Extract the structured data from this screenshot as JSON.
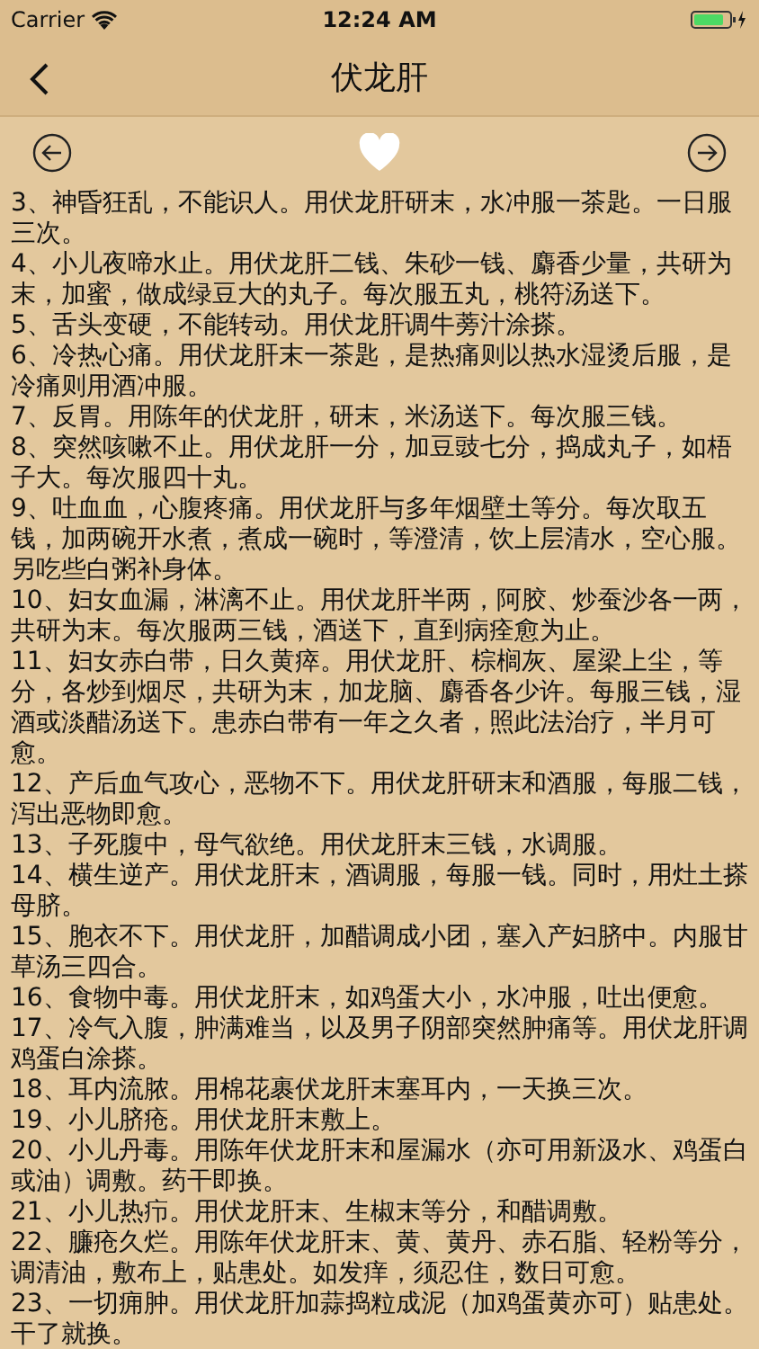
{
  "status_bar": {
    "carrier": "Carrier",
    "time": "12:24 AM",
    "charging": true
  },
  "nav": {
    "title": "伏龙肝"
  },
  "toolbar": {
    "favorite": true
  },
  "paragraphs": [
    "3、神昏狂乱，不能识人。用伏龙肝研末，水冲服一茶匙。一日服三次。",
    "4、小儿夜啼水止。用伏龙肝二钱、朱砂一钱、麝香少量，共研为末，加蜜，做成绿豆大的丸子。每次服五丸，桃符汤送下。",
    "5、舌头变硬，不能转动。用伏龙肝调牛蒡汁涂搽。",
    "6、冷热心痛。用伏龙肝末一茶匙，是热痛则以热水湿烫后服，是冷痛则用酒冲服。",
    "7、反胃。用陈年的伏龙肝，研末，米汤送下。每次服三钱。",
    "8、突然咳嗽不止。用伏龙肝一分，加豆豉七分，捣成丸子，如梧子大。每次服四十丸。",
    "9、吐血血，心腹疼痛。用伏龙肝与多年烟壁土等分。每次取五钱，加两碗开水煮，煮成一碗时，等澄清，饮上层清水，空心服。另吃些白粥补身体。",
    "10、妇女血漏，淋漓不止。用伏龙肝半两，阿胶、炒蚕沙各一两，共研为末。每次服两三钱，酒送下，直到病痊愈为止。",
    "11、妇女赤白带，日久黄瘁。用伏龙肝、棕榈灰、屋梁上尘，等分，各炒到烟尽，共研为末，加龙脑、麝香各少许。每服三钱，湿酒或淡醋汤送下。患赤白带有一年之久者，照此法治疗，半月可愈。",
    "12、产后血气攻心，恶物不下。用伏龙肝研末和酒服，每服二钱，泻出恶物即愈。",
    "13、子死腹中，母气欲绝。用伏龙肝末三钱，水调服。",
    "14、横生逆产。用伏龙肝末，酒调服，每服一钱。同时，用灶土搽母脐。",
    "15、胞衣不下。用伏龙肝，加醋调成小团，塞入产妇脐中。内服甘草汤三四合。",
    "16、食物中毒。用伏龙肝末，如鸡蛋大小，水冲服，吐出便愈。",
    "17、冷气入腹，肿满难当，以及男子阴部突然肿痛等。用伏龙肝调鸡蛋白涂搽。",
    "18、耳内流脓。用棉花裹伏龙肝末塞耳内，一天换三次。",
    "19、小儿脐疮。用伏龙肝末敷上。",
    "20、小儿丹毒。用陈年伏龙肝末和屋漏水（亦可用新汲水、鸡蛋白或油）调敷。药干即换。",
    "21、小儿热疖。用伏龙肝末、生椒末等分，和醋调敷。",
    "22、臁疮久烂。用陈年伏龙肝末、黄、黄丹、赤石脂、轻粉等分，调清油，敷布上，贴患处。如发痒，须忍住，数日可愈。",
    "23、一切痈肿。用伏龙肝加蒜捣粒成泥（加鸡蛋黄亦可）贴患处。干了就换。"
  ]
}
